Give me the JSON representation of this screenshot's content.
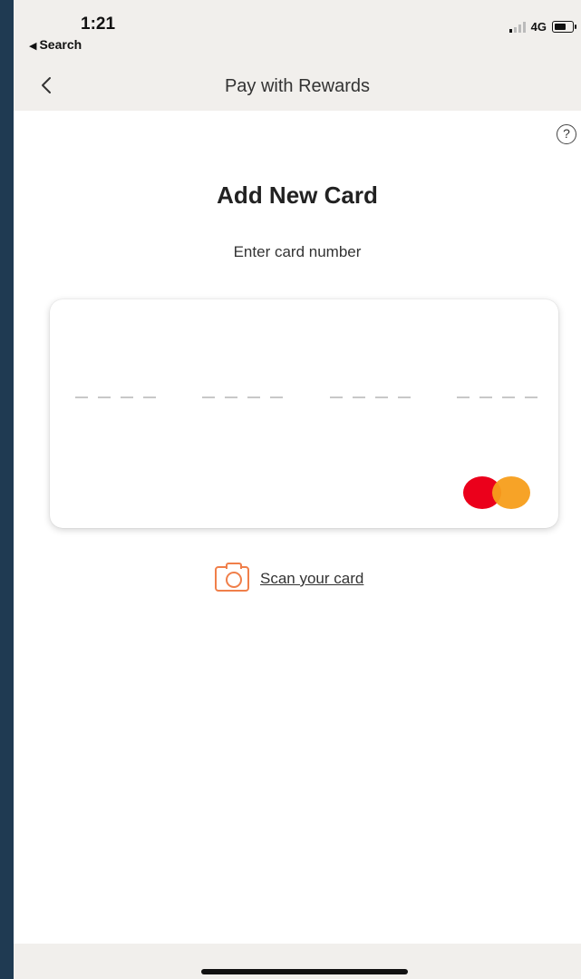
{
  "status_bar": {
    "time": "1:21",
    "back_app": "Search",
    "network": "4G"
  },
  "nav": {
    "title": "Pay with Rewards"
  },
  "help": {
    "glyph": "?"
  },
  "content": {
    "title": "Add New Card",
    "subtitle": "Enter card number"
  },
  "card": {
    "number_placeholder_groups": 4,
    "brand_icon": "mastercard-icon",
    "brand_colors": [
      "#eb001b",
      "#f79e1b"
    ]
  },
  "scan": {
    "label": "Scan your card",
    "icon": "camera-icon",
    "accent": "#f07f4a"
  }
}
